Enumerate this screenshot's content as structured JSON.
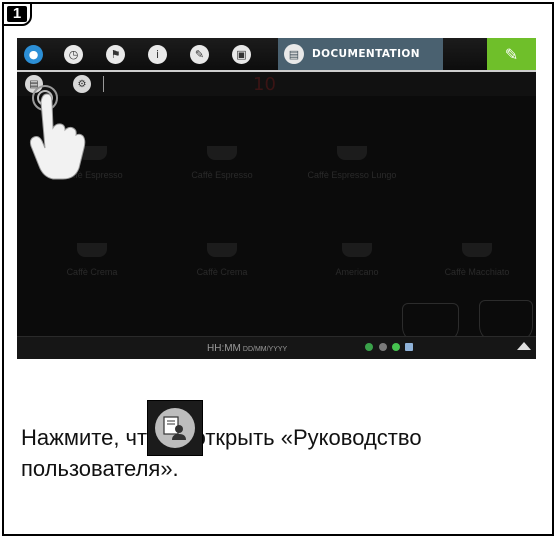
{
  "step": {
    "number": "1"
  },
  "screen": {
    "topbar": {
      "icons": [
        "water-drop-icon",
        "clock-icon",
        "flag-icon",
        "info-icon",
        "pencil-icon",
        "monitor-icon"
      ],
      "doc_tab_label": "DOCUMENTATION",
      "wrench_icon": "wrench-icon",
      "accent_color": "#6fbf2a",
      "doc_tab_color": "#4a6170"
    },
    "subbar": {
      "faint_value": "10"
    },
    "grid": {
      "row1": [
        "Caffè Espresso",
        "Caffè Espresso",
        "Caffè Espresso Lungo"
      ],
      "row2": [
        "Caffè Crema",
        "Caffè Crema",
        "Americano",
        "Caffè Macchiato"
      ]
    },
    "bottombar": {
      "time": "HH:MM",
      "date": "DD/MM/YYYY"
    }
  },
  "instruction": {
    "line1_before": "Нажмите, ",
    "line1_after": "чтобы открыть «Руководство",
    "line2": "пользователя»."
  }
}
